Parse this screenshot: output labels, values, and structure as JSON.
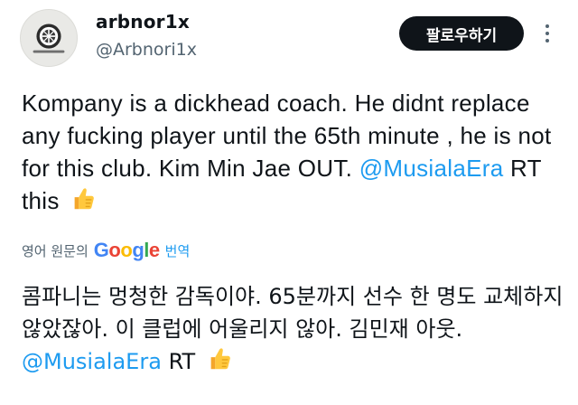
{
  "author": {
    "display_name": "arbnor1x",
    "handle": "@Arbnori1x",
    "avatar_icon": "bayern-crest-avatar"
  },
  "follow_label": "팔로우하기",
  "more_icon": "more-vertical-icon",
  "tweet": {
    "body": "Kompany is a dickhead coach. He didnt replace any fucking player until the 65th minute , he is not for this club. Kim Min Jae OUT.",
    "mention": "@MusialaEra",
    "tail": "RT this",
    "emoji": "thumbs-up-icon"
  },
  "translation_bar": {
    "source": "영어 원문의",
    "google_letters": [
      "G",
      "o",
      "o",
      "g",
      "l",
      "e"
    ],
    "action": "번역"
  },
  "translation": {
    "body": "콤파니는 멍청한 감독이야. 65분까지 선수 한 명도 교체하지 않았잖아. 이 클럽에 어울리지 않아. 김민재 아웃.",
    "mention": "@MusialaEra",
    "tail": "RT",
    "emoji": "thumbs-up-icon"
  },
  "colors": {
    "link": "#1d9bf0",
    "muted": "#536471",
    "button_bg": "#0f1419"
  }
}
